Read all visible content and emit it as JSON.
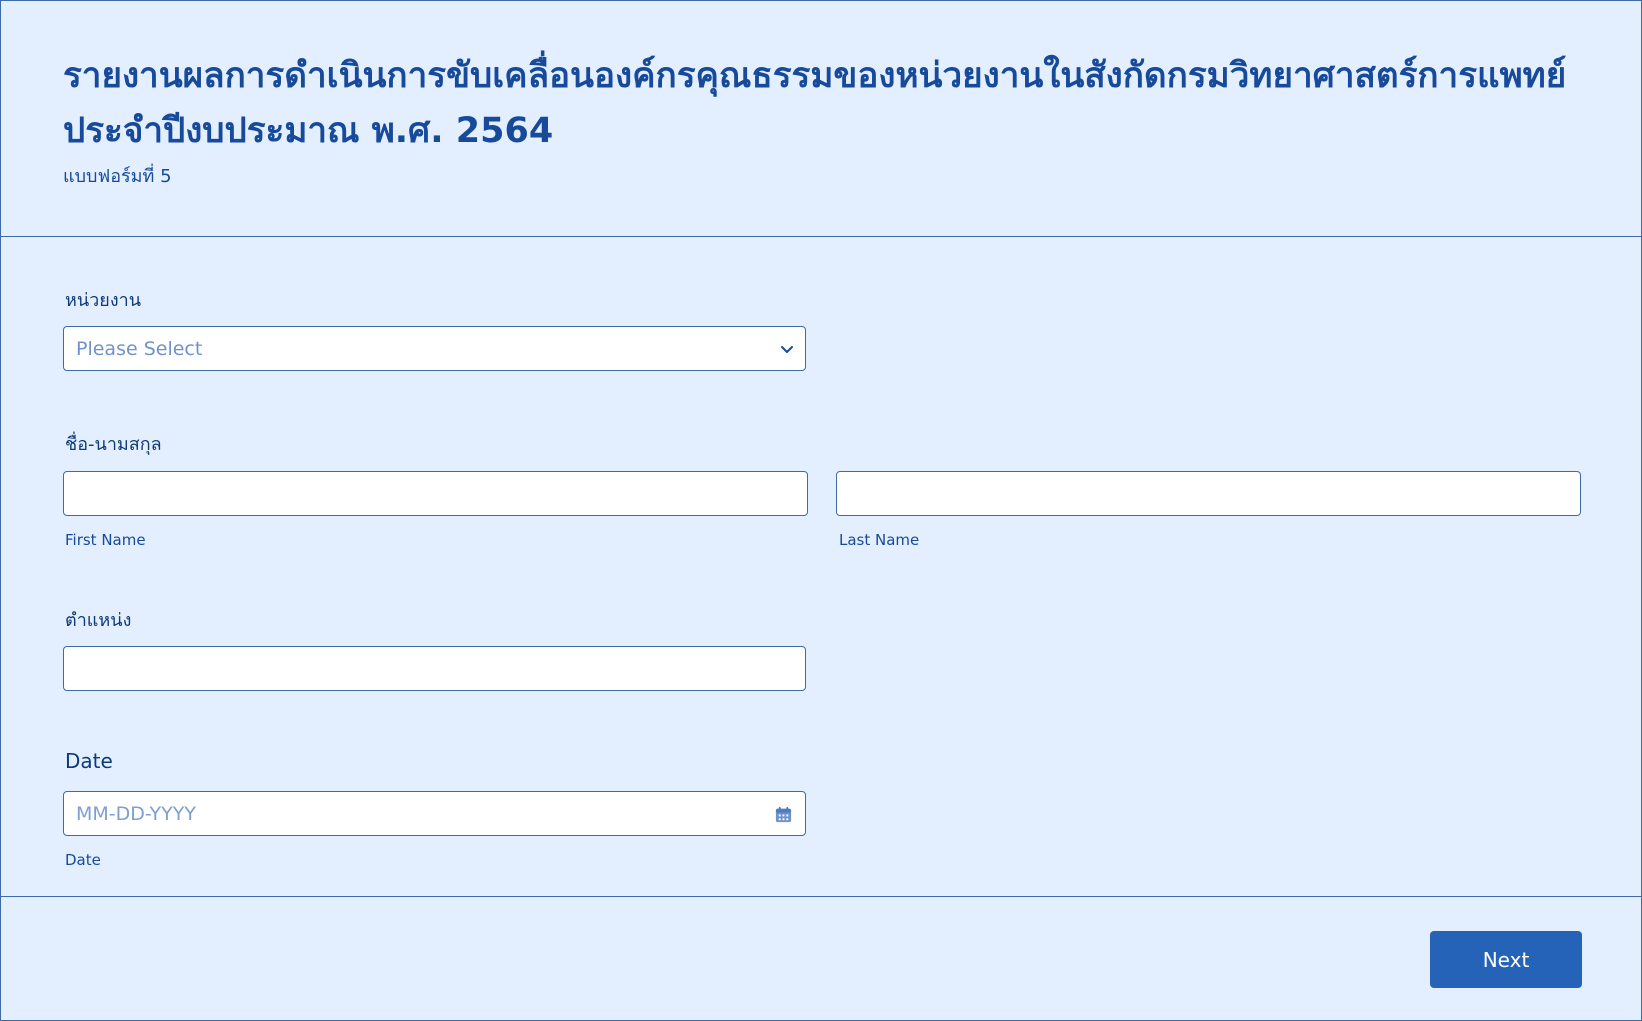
{
  "form": {
    "title_line1": "รายงานผลการดำเนินการขับเคลื่อนองค์กรคุณธรรมของหน่วยงานในสังกัดกรมวิทยาศาสตร์การแพทย์",
    "title_line2": "ประจำปีงบประมาณ พ.ศ. 2564",
    "subtitle": "แบบฟอร์มที่ 5"
  },
  "fields": {
    "unit": {
      "label": "หน่วยงาน",
      "value": "Please Select"
    },
    "name": {
      "label": "ชื่อ-นามสกุล",
      "first_value": "",
      "last_value": "",
      "first_sublabel": "First Name",
      "last_sublabel": "Last Name"
    },
    "position": {
      "label": "ตำแหน่ง",
      "value": ""
    },
    "date": {
      "label": "Date",
      "placeholder": "MM-DD-YYYY",
      "sublabel": "Date",
      "value": ""
    }
  },
  "actions": {
    "next_label": "Next"
  },
  "colors": {
    "background": "#e3efff",
    "title": "#174a9a",
    "border": "#3f6aa8",
    "button": "#2563b8",
    "button_text": "#ffffff"
  },
  "icons": {
    "dropdown": "chevron-down-icon",
    "date": "calendar-icon"
  }
}
